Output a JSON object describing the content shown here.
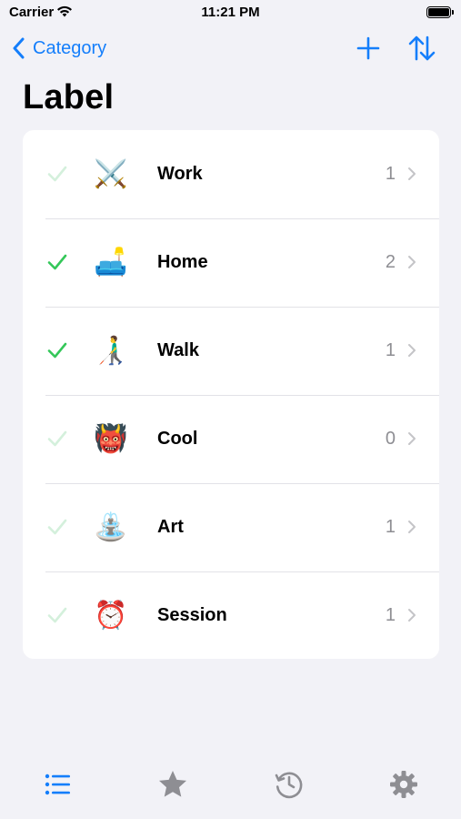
{
  "status_bar": {
    "carrier": "Carrier",
    "time": "11:21 PM"
  },
  "nav": {
    "back_label": "Category",
    "add_icon": "plus-icon",
    "sort_icon": "sort-arrows-icon"
  },
  "page": {
    "title": "Label"
  },
  "colors": {
    "accent": "#147efb",
    "check_active": "#34c759",
    "check_inactive": "#d4f0dc",
    "tab_active": "#147efb",
    "tab_inactive": "#8e8e93"
  },
  "items": [
    {
      "emoji": "⚔️",
      "label": "Work",
      "count": "1",
      "checked": false
    },
    {
      "emoji": "🛋️",
      "label": "Home",
      "count": "2",
      "checked": true
    },
    {
      "emoji": "👨‍🦯",
      "label": "Walk",
      "count": "1",
      "checked": true
    },
    {
      "emoji": "👹",
      "label": "Cool",
      "count": "0",
      "checked": false
    },
    {
      "emoji": "⛲",
      "label": "Art",
      "count": "1",
      "checked": false
    },
    {
      "emoji": "⏰",
      "label": "Session",
      "count": "1",
      "checked": false
    }
  ],
  "tab_bar": {
    "tabs": [
      {
        "icon": "list-icon",
        "active": true
      },
      {
        "icon": "star-icon",
        "active": false
      },
      {
        "icon": "history-icon",
        "active": false
      },
      {
        "icon": "gear-icon",
        "active": false
      }
    ]
  }
}
